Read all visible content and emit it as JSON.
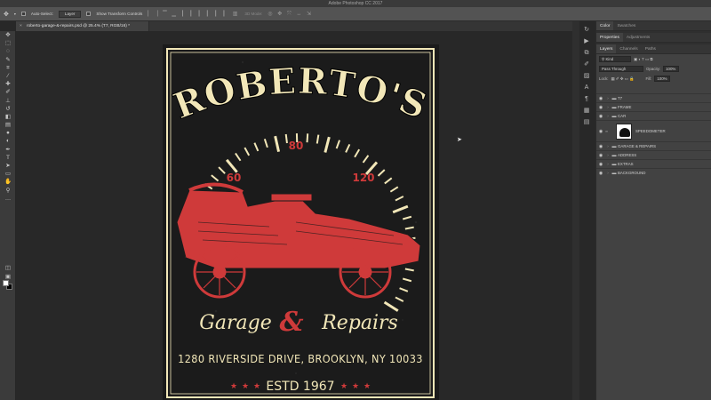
{
  "app": {
    "title": "Adobe Photoshop CC 2017"
  },
  "options_bar": {
    "move_icon": "move-icon",
    "auto_select_label": "Auto-Select:",
    "auto_select_value": "Layer",
    "show_transform_label": "Show Transform Controls",
    "mode_3d_label": "3D Mode:"
  },
  "document": {
    "tab_title": "roberto-garage-&-repairs.psd @ 25.4% (T7, RGB/16) *",
    "close_glyph": "×"
  },
  "artwork": {
    "brand": "ROBERTO'S",
    "speed_60": "60",
    "speed_80": "80",
    "speed_120": "120",
    "garage": "Garage",
    "amp": "&",
    "repairs": "Repairs",
    "address": "1280 RIVERSIDE DRIVE, BROOKLYN, NY 10033",
    "established": "ESTD 1967",
    "colors": {
      "cream": "#f2e7b8",
      "red": "#cf3a3a",
      "board": "#1b1b1b"
    }
  },
  "right_panel": {
    "top_tabs": [
      "Color",
      "Swatches"
    ],
    "mid_tabs": [
      "Properties",
      "Adjustments"
    ],
    "layer_tabs": [
      "Layers",
      "Channels",
      "Paths"
    ],
    "filter": "Kind",
    "blend_mode": "Pass Through",
    "opacity_label": "Opacity:",
    "opacity_value": "100%",
    "lock_label": "Lock:",
    "fill_label": "Fill:",
    "fill_value": "100%",
    "layers": [
      {
        "name": "T7"
      },
      {
        "name": "FRAME"
      },
      {
        "name": "CAR"
      },
      {
        "name": "SPEEDOMETER"
      },
      {
        "name": "GARAGE & REPAIRS"
      },
      {
        "name": "ADDRESS"
      },
      {
        "name": "EXTRAS"
      },
      {
        "name": "BACKGROUND"
      }
    ]
  }
}
